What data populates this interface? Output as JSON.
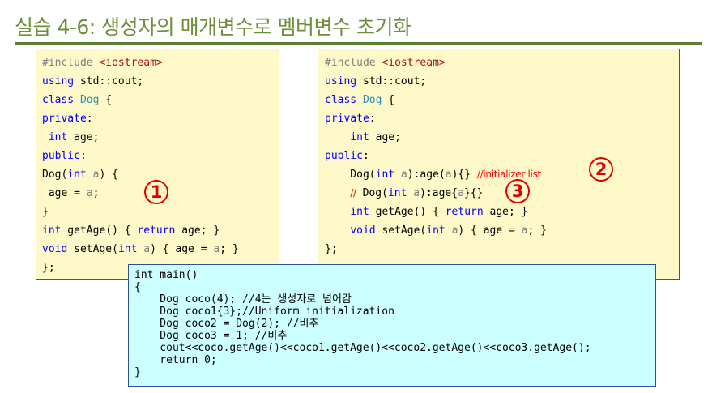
{
  "title": "실습 4-6: 생성자의 매개변수로 멤버변수 초기화",
  "left_code": [
    [
      {
        "t": "#include ",
        "c": "pp"
      },
      {
        "t": "<iostream>",
        "c": "str"
      }
    ],
    [
      {
        "t": "using",
        "c": "kw"
      },
      {
        "t": " std::cout;"
      }
    ],
    [
      {
        "t": "class",
        "c": "kw"
      },
      {
        "t": " "
      },
      {
        "t": "Dog",
        "c": "cls"
      },
      {
        "t": " {"
      }
    ],
    [
      {
        "t": "private",
        "c": "kw"
      },
      {
        "t": ":"
      }
    ],
    [
      {
        "t": " "
      },
      {
        "t": "int",
        "c": "kw"
      },
      {
        "t": " age;"
      }
    ],
    [
      {
        "t": "public",
        "c": "kw"
      },
      {
        "t": ":"
      }
    ],
    [
      {
        "t": "Dog("
      },
      {
        "t": "int",
        "c": "kw"
      },
      {
        "t": " "
      },
      {
        "t": "a",
        "c": "prm"
      },
      {
        "t": ") {"
      }
    ],
    [
      {
        "t": " age = "
      },
      {
        "t": "a",
        "c": "prm"
      },
      {
        "t": ";"
      }
    ],
    [
      {
        "t": "}"
      }
    ],
    [
      {
        "t": "int",
        "c": "kw"
      },
      {
        "t": " getAge() { "
      },
      {
        "t": "return",
        "c": "kw"
      },
      {
        "t": " age; }"
      }
    ],
    [
      {
        "t": "void",
        "c": "kw"
      },
      {
        "t": " setAge("
      },
      {
        "t": "int",
        "c": "kw"
      },
      {
        "t": " "
      },
      {
        "t": "a",
        "c": "prm"
      },
      {
        "t": ") { age = "
      },
      {
        "t": "a",
        "c": "prm"
      },
      {
        "t": "; }"
      }
    ],
    [
      {
        "t": "};"
      }
    ]
  ],
  "right_code": [
    [
      {
        "t": "#include ",
        "c": "pp"
      },
      {
        "t": "<iostream>",
        "c": "str"
      }
    ],
    [
      {
        "t": "using",
        "c": "kw"
      },
      {
        "t": " std::cout;"
      }
    ],
    [
      {
        "t": "class",
        "c": "kw"
      },
      {
        "t": " "
      },
      {
        "t": "Dog",
        "c": "cls"
      },
      {
        "t": " {"
      }
    ],
    [
      {
        "t": "private",
        "c": "kw"
      },
      {
        "t": ":"
      }
    ],
    [
      {
        "t": "    "
      },
      {
        "t": "int",
        "c": "kw"
      },
      {
        "t": " age;"
      }
    ],
    [
      {
        "t": "public",
        "c": "kw"
      },
      {
        "t": ":"
      }
    ],
    [
      {
        "t": "    Dog("
      },
      {
        "t": "int",
        "c": "kw"
      },
      {
        "t": " "
      },
      {
        "t": "a",
        "c": "prm"
      },
      {
        "t": "):age("
      },
      {
        "t": "a",
        "c": "prm"
      },
      {
        "t": "){} "
      },
      {
        "t": "//initializer list",
        "c": "cm"
      }
    ],
    [
      {
        "t": "    "
      },
      {
        "t": "//",
        "c": "cm"
      },
      {
        "t": " Dog("
      },
      {
        "t": "int",
        "c": "kw"
      },
      {
        "t": " "
      },
      {
        "t": "a",
        "c": "prm"
      },
      {
        "t": "):age{"
      },
      {
        "t": "a",
        "c": "prm"
      },
      {
        "t": "}{}"
      }
    ],
    [
      {
        "t": "    "
      },
      {
        "t": "int",
        "c": "kw"
      },
      {
        "t": " getAge() { "
      },
      {
        "t": "return",
        "c": "kw"
      },
      {
        "t": " age; }"
      }
    ],
    [
      {
        "t": "    "
      },
      {
        "t": "void",
        "c": "kw"
      },
      {
        "t": " setAge("
      },
      {
        "t": "int",
        "c": "kw"
      },
      {
        "t": " "
      },
      {
        "t": "a",
        "c": "prm"
      },
      {
        "t": ") { age = "
      },
      {
        "t": "a",
        "c": "prm"
      },
      {
        "t": "; }"
      }
    ],
    [
      {
        "t": "};"
      }
    ]
  ],
  "main_code": [
    "int main()",
    "{",
    "    Dog coco(4); //4는 생성자로 넘어감",
    "    Dog coco1{3};//Uniform initialization",
    "    Dog coco2 = Dog(2); //비추",
    "    Dog coco3 = 1; //비추",
    "    cout<<coco.getAge()<<coco1.getAge()<<coco2.getAge()<<coco3.getAge();",
    "    return 0;",
    "}"
  ],
  "badges": {
    "b1": "1",
    "b2": "2",
    "b3": "3"
  },
  "colors": {
    "title": "#6f8f3a",
    "rule": "#5d7f33",
    "code_bg": "#fff8c9",
    "main_bg": "#ccffff",
    "badge": "#e00000"
  }
}
